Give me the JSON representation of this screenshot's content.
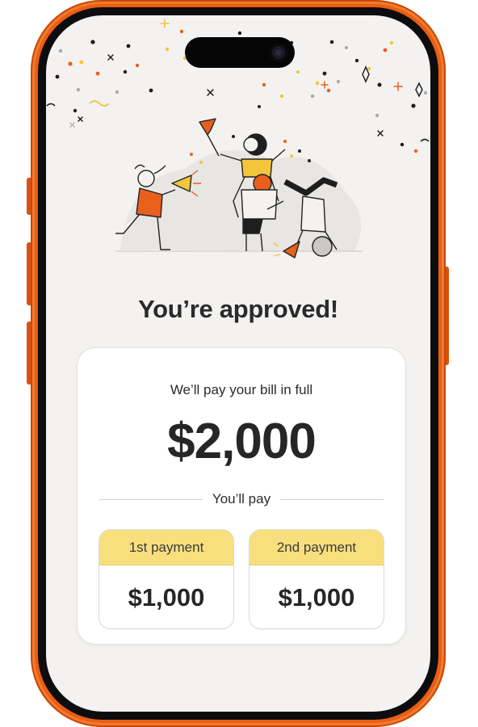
{
  "headline": "You’re approved!",
  "summary": {
    "subtitle": "We’ll pay your bill in full",
    "amount": "$2,000",
    "you_pay_label": "You’ll pay"
  },
  "payments": [
    {
      "label": "1st payment",
      "amount": "$1,000"
    },
    {
      "label": "2nd payment",
      "amount": "$1,000"
    }
  ],
  "colors": {
    "phone_frame": "#ea5e14",
    "screen_bg": "#f3f2f0",
    "payment_header": "#f7df7d",
    "text": "#262626"
  },
  "icons": [
    "confetti-decoration",
    "celebration-illustration",
    "camera-icon"
  ]
}
